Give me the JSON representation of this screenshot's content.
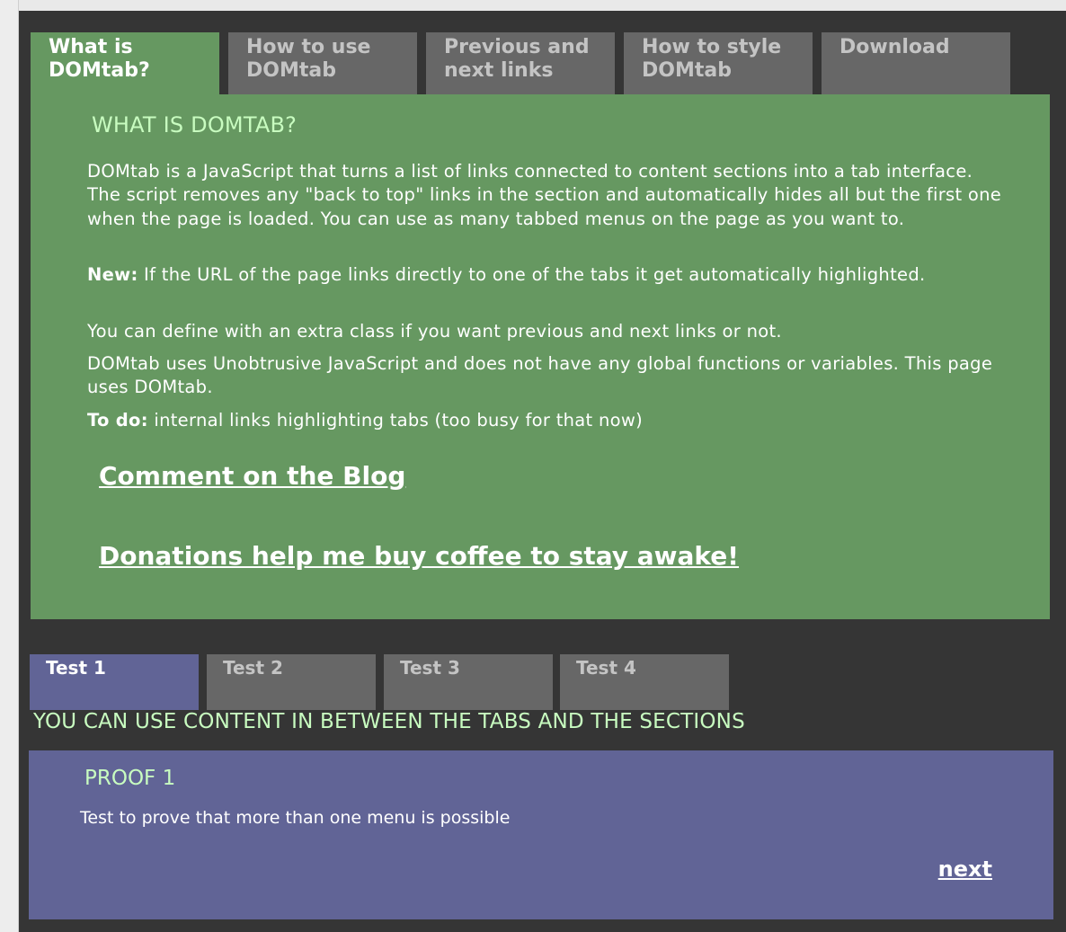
{
  "menu1": {
    "tabs": [
      {
        "line1": "What is",
        "line2": "DOMtab?"
      },
      {
        "line1": "How to use",
        "line2": "DOMtab"
      },
      {
        "line1": "Previous and",
        "line2": "next links"
      },
      {
        "line1": "How to style",
        "line2": "DOMtab"
      },
      {
        "line1": "Download",
        "line2": ""
      }
    ],
    "active_index": 0
  },
  "section1": {
    "heading": "WHAT IS DOMTAB?",
    "paragraph1": "DOMtab is a JavaScript that turns a list of links connected to content sections into a tab interface. The script removes any \"back to top\" links in the section and automatically hides all but the first one when the page is loaded. You can use as many tabbed menus on the page as you want to.",
    "paragraph2_label": "New:",
    "paragraph2": " If the URL of the page links directly to one of the tabs it get automatically highlighted.",
    "paragraph3": "You can define with an extra class if you want previous and next links or not.",
    "paragraph4": "DOMtab uses Unobtrusive JavaScript and does not have any global functions or variables. This page uses DOMtab.",
    "paragraph5_label": "To do:",
    "paragraph5": " internal links highlighting tabs (too busy for that now)",
    "link_comment": "Comment on the Blog",
    "link_donate": "Donations help me buy coffee to stay awake!"
  },
  "menu2": {
    "tabs": [
      "Test 1",
      "Test 2",
      "Test 3",
      "Test 4"
    ],
    "active_index": 0
  },
  "between_text": "YOU CAN USE CONTENT IN BETWEEN THE TABS AND THE SECTIONS",
  "section2": {
    "heading": "PROOF 1",
    "text": "Test to prove that more than one menu is possible",
    "next_label": "next"
  },
  "colors": {
    "frame": "#353535",
    "tab_inactive": "#676767",
    "tab_active_green": "#669861",
    "tab_active_purple": "#616496",
    "heading_green": "#c8fcc0"
  }
}
